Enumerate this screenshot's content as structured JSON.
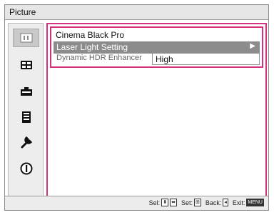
{
  "window": {
    "title": "Picture"
  },
  "sidebar": {
    "items": [
      {
        "icon": "picture-icon",
        "selected": true
      },
      {
        "icon": "screen-icon",
        "selected": false
      },
      {
        "icon": "setup-icon",
        "selected": false
      },
      {
        "icon": "function-icon",
        "selected": false
      },
      {
        "icon": "wrench-icon",
        "selected": false
      },
      {
        "icon": "info-icon",
        "selected": false
      }
    ]
  },
  "menu": {
    "header": "Cinema Black Pro",
    "selected_item": {
      "label": "Laser Light Setting",
      "arrow": "▶"
    },
    "option": {
      "label": "Dynamic HDR Enhancer",
      "value": "High"
    }
  },
  "footer": {
    "sel_label": "Sel:",
    "set_label": "Set:",
    "back_label": "Back:",
    "exit_label": "Exit:",
    "exit_key": "MENU"
  },
  "colors": {
    "accent": "#d2327e",
    "selected_row": "#8c8c8c"
  }
}
